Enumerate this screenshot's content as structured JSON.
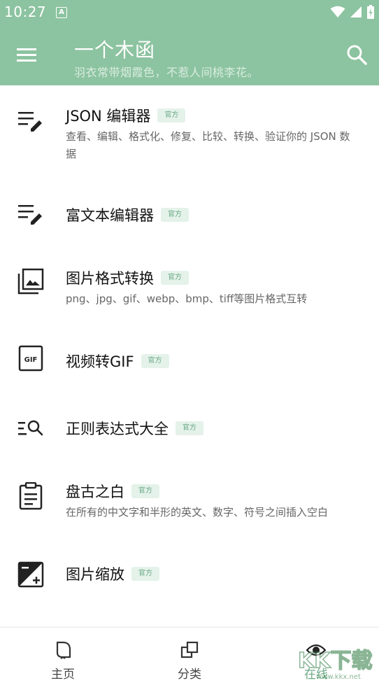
{
  "status_bar": {
    "time": "10:27",
    "notification_icon": "A"
  },
  "header": {
    "title": "一个木函",
    "subtitle": "羽衣常带烟霞色，不惹人间桃李花。"
  },
  "items": [
    {
      "title": "JSON 编辑器",
      "badge": "官方",
      "description": "查看、编辑、格式化、修复、比较、转换、验证你的 JSON 数据",
      "icon": "edit-notes-icon"
    },
    {
      "title": "富文本编辑器",
      "badge": "官方",
      "description": "",
      "icon": "edit-notes-icon"
    },
    {
      "title": "图片格式转换",
      "badge": "官方",
      "description": "png、jpg、gif、webp、bmp、tiff等图片格式互转",
      "icon": "photo-library-icon"
    },
    {
      "title": "视频转GIF",
      "badge": "官方",
      "description": "",
      "icon": "gif-icon"
    },
    {
      "title": "正则表达式大全",
      "badge": "官方",
      "description": "",
      "icon": "list-search-icon"
    },
    {
      "title": "盘古之白",
      "badge": "官方",
      "description": "在所有的中文字和半形的英文、数字、符号之间插入空白",
      "icon": "clipboard-list-icon"
    },
    {
      "title": "图片缩放",
      "badge": "官方",
      "description": "",
      "icon": "exposure-icon"
    }
  ],
  "bottom_nav": {
    "items": [
      {
        "label": "主页",
        "icon": "home-icon",
        "active": false
      },
      {
        "label": "分类",
        "icon": "category-icon",
        "active": false
      },
      {
        "label": "在线",
        "icon": "eye-icon",
        "active": true
      }
    ]
  },
  "watermark": {
    "text": "KK下载",
    "url_text": "www.kkx.net"
  },
  "colors": {
    "header_bg": "#8cc3a0",
    "accent": "#6aa985",
    "badge_bg": "#e4f2ea"
  }
}
